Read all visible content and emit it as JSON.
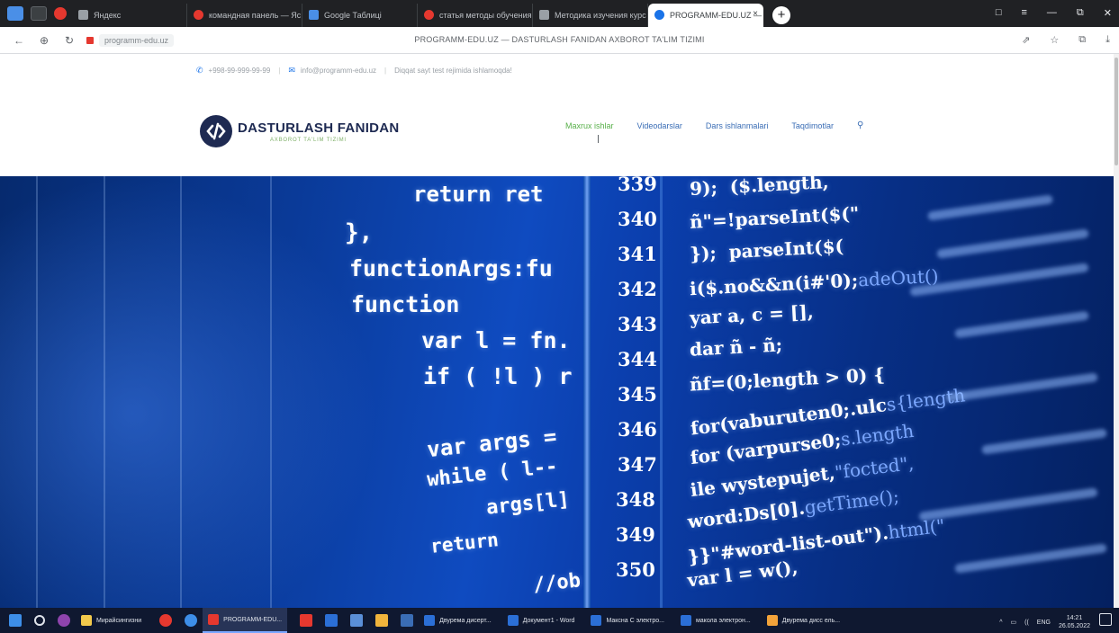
{
  "browser": {
    "tabs": [
      {
        "label": "Яндекс",
        "icon": "yandex-favicon"
      },
      {
        "label": "командная панель — Яс",
        "icon": "red-favicon"
      },
      {
        "label": "Google Таблиці",
        "icon": "sheets-favicon"
      },
      {
        "label": "статья методы обучения",
        "icon": "red-favicon"
      },
      {
        "label": "Методика изучения курс",
        "icon": "page-favicon"
      },
      {
        "label": "PROGRAMM-EDU.UZ — Д",
        "icon": "site-favicon",
        "active": true
      }
    ],
    "new_tab": "+",
    "window_controls": [
      "□",
      "≡",
      "—",
      "⧉",
      "✕"
    ],
    "address": {
      "host": "programm-edu.uz",
      "page_title": "PROGRAMM-EDU.UZ — DASTURLASH FANIDAN AXBOROT TA'LIM TIZIMI",
      "right_icons": [
        "⇗",
        "☆",
        "⧉",
        "⤓"
      ]
    }
  },
  "site": {
    "topbar": {
      "phone": "+998-99-999-99-99",
      "email": "info@programm-edu.uz",
      "note": "Diqqat sayt test rejimida ishlamoqda!"
    },
    "logo": {
      "title": "DASTURLASH FANIDAN",
      "subtitle": "AXBOROT TA'LIM TIZIMI"
    },
    "menu": [
      {
        "label": "Maxrux ishlar",
        "active": true
      },
      {
        "label": "Videodarslar"
      },
      {
        "label": "Dars ishlanmalari"
      },
      {
        "label": "Taqdimotlar"
      }
    ],
    "search_icon": "search-icon",
    "hero": {
      "left_code": [
        "return ret",
        "},",
        "functionArgs:fu",
        "function",
        "var l = fn.",
        "if ( !l ) r",
        "var args = ",
        "while ( l--",
        "args[l]",
        "return",
        "//ob"
      ],
      "line_numbers": [
        "339",
        "340",
        "341",
        "342",
        "343",
        "344",
        "345",
        "346",
        "347",
        "348",
        "349",
        "350"
      ],
      "right_code": [
        "9);  ($.length,",
        "ñ\"=!parseInt($(\"",
        "});  parseInt($(",
        "i($.no&&n(i#'0);",
        "yar a, c = [],",
        "dar ñ - ñ;",
        "ñf=(0;length > 0) {",
        "for(vaburuten0;.ulc",
        "for (varpurse0;",
        "ile wystepujet,",
        "word:Ds[0].",
        "}}\"#word-list-out\").",
        "var l = w(),"
      ],
      "right_code_dim": [
        "",
        "",
        "",
        "adeOut()",
        "",
        "",
        "",
        "s{length",
        "s.length",
        "\"focted\",",
        "getTime();",
        "html(\"",
        ""
      ]
    }
  },
  "taskbar": {
    "apps": [
      {
        "label": "Мирайсингизни",
        "color": "#f2c94c"
      },
      {
        "label": "PROGRAMM-EDU...",
        "color": "#e5382f",
        "active": true
      },
      {
        "label": "Двурема дисерт...",
        "color": "#2b6fd6"
      },
      {
        "label": "Документ1 - Word",
        "color": "#2b6fd6"
      },
      {
        "label": "Максна С электро...",
        "color": "#2b6fd6"
      },
      {
        "label": "макола электрон...",
        "color": "#2b6fd6"
      },
      {
        "label": "Двурема дисс ель...",
        "color": "#f2a33a"
      }
    ],
    "tray": [
      "^",
      "▭",
      "((",
      "ENG"
    ],
    "time": "14:21",
    "date": "26.05.2022"
  }
}
